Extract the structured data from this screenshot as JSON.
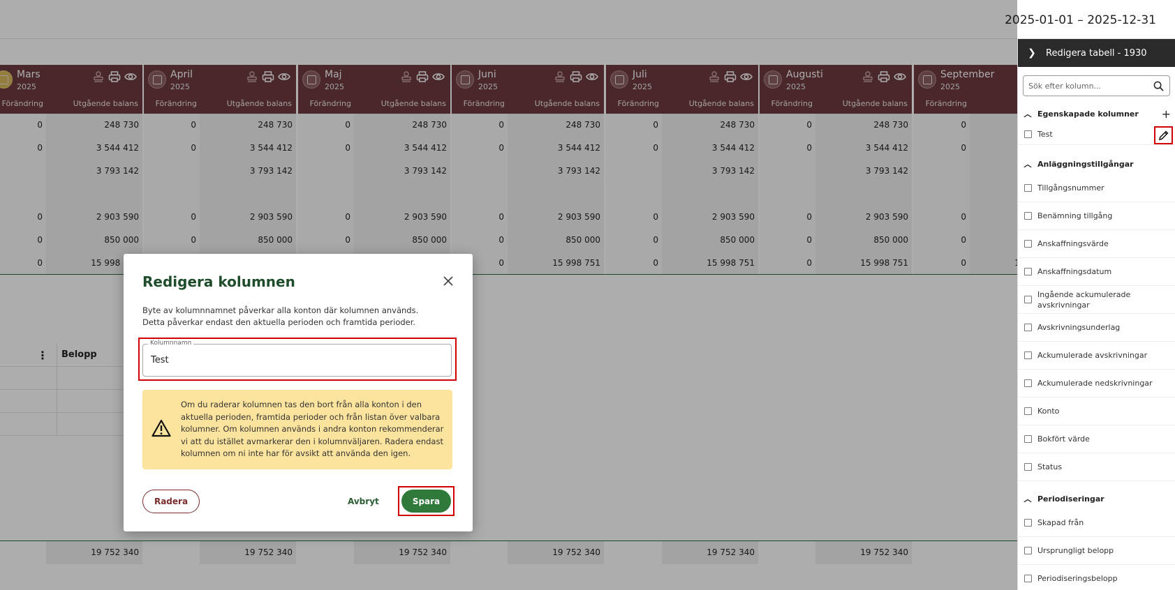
{
  "header": {
    "date_range": "2025-01-01 – 2025-12-31"
  },
  "months": [
    {
      "name": "Mars",
      "year": "2025",
      "highlight": true
    },
    {
      "name": "April",
      "year": "2025",
      "highlight": false
    },
    {
      "name": "Maj",
      "year": "2025",
      "highlight": false
    },
    {
      "name": "Juni",
      "year": "2025",
      "highlight": false
    },
    {
      "name": "Juli",
      "year": "2025",
      "highlight": false
    },
    {
      "name": "Augusti",
      "year": "2025",
      "highlight": false
    },
    {
      "name": "September",
      "year": "2025",
      "highlight": false
    }
  ],
  "sub_headers": {
    "change": "Förändring",
    "closing": "Utgående balans"
  },
  "rows": [
    {
      "change": "0",
      "closing": "248 730"
    },
    {
      "change": "0",
      "closing": "3 544 412"
    },
    {
      "change": "",
      "closing": "3 793 142"
    },
    {
      "change": "",
      "closing": ""
    },
    {
      "change": "0",
      "closing": "2 903 590"
    },
    {
      "change": "0",
      "closing": "850 000"
    },
    {
      "change": "0",
      "closing": "15 998 751"
    }
  ],
  "mini_table": {
    "menu_glyph": "⋮",
    "amount_header": "Belopp"
  },
  "bottom_total": "19 752 340",
  "panel": {
    "title": "Redigera tabell - 1930",
    "search_placeholder": "Sök efter kolumn...",
    "sections": {
      "custom": {
        "title": "Egenskapade kolumner",
        "items": [
          "Test"
        ]
      },
      "assets": {
        "title": "Anläggningstillgångar",
        "items": [
          "Tillgångsnummer",
          "Benämning tillgång",
          "Anskaffningsvärde",
          "Anskaffningsdatum",
          "Ingående ackumulerade avskrivningar",
          "Avskrivningsunderlag",
          "Ackumulerade avskrivningar",
          "Ackumulerade nedskrivningar",
          "Konto",
          "Bokfört värde",
          "Status"
        ]
      },
      "accruals": {
        "title": "Periodiseringar",
        "items": [
          "Skapad från",
          "Ursprungligt belopp",
          "Periodiseringsbelopp"
        ]
      }
    }
  },
  "dialog": {
    "title": "Redigera kolumnen",
    "description": "Byte av kolumnnamnet påverkar alla konton där kolumnen används. Detta påverkar endast den aktuella perioden och framtida perioder.",
    "field_label": "Kolumnnamn",
    "field_value": "Test",
    "warning": "Om du raderar kolumnen tas den bort från alla konton i den aktuella perioden, framtida perioder och från listan över valbara kolumner. Om kolumnen används i andra konton rekommenderar vi att du istället avmarkerar den i kolumnväljaren. Radera endast kolumnen om ni inte har för avsikt att använda den igen.",
    "delete_label": "Radera",
    "cancel_label": "Avbryt",
    "save_label": "Spara"
  },
  "colors": {
    "month_header": "#6e3a3f",
    "panel_header": "#2a2a2a",
    "save_green": "#2f7a3b",
    "title_green": "#1f4d2b",
    "warning_bg": "#fde49e",
    "highlight_red": "#d10000"
  }
}
